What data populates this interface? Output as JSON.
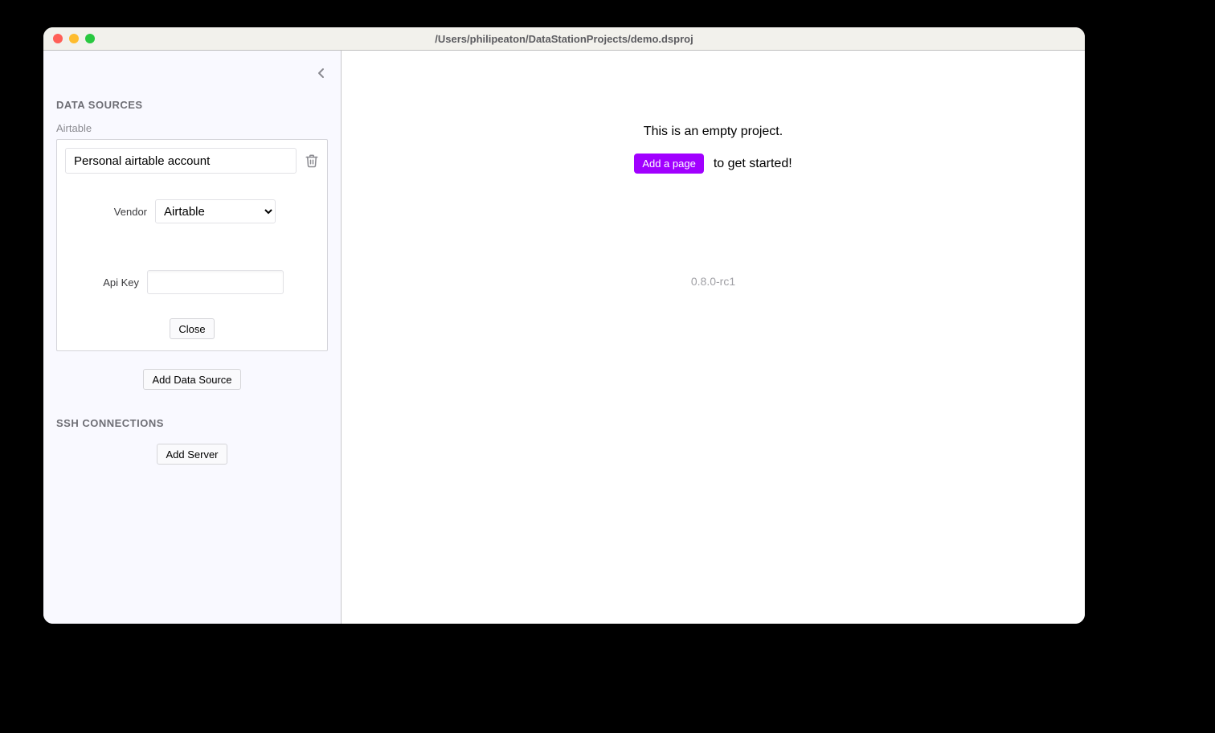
{
  "window": {
    "title": "/Users/philipeaton/DataStationProjects/demo.dsproj"
  },
  "sidebar": {
    "data_sources_heading": "DATA SOURCES",
    "source_type_label": "Airtable",
    "source": {
      "name": "Personal airtable account",
      "vendor_label": "Vendor",
      "vendor_value": "Airtable",
      "api_key_label": "Api Key",
      "api_key_value": "",
      "close_btn": "Close"
    },
    "add_data_source_btn": "Add Data Source",
    "ssh_heading": "SSH CONNECTIONS",
    "add_server_btn": "Add Server"
  },
  "main": {
    "empty_line1": "This is an empty project.",
    "add_page_btn": "Add a page",
    "empty_line2_suffix": "to get started!",
    "version": "0.8.0-rc1"
  }
}
